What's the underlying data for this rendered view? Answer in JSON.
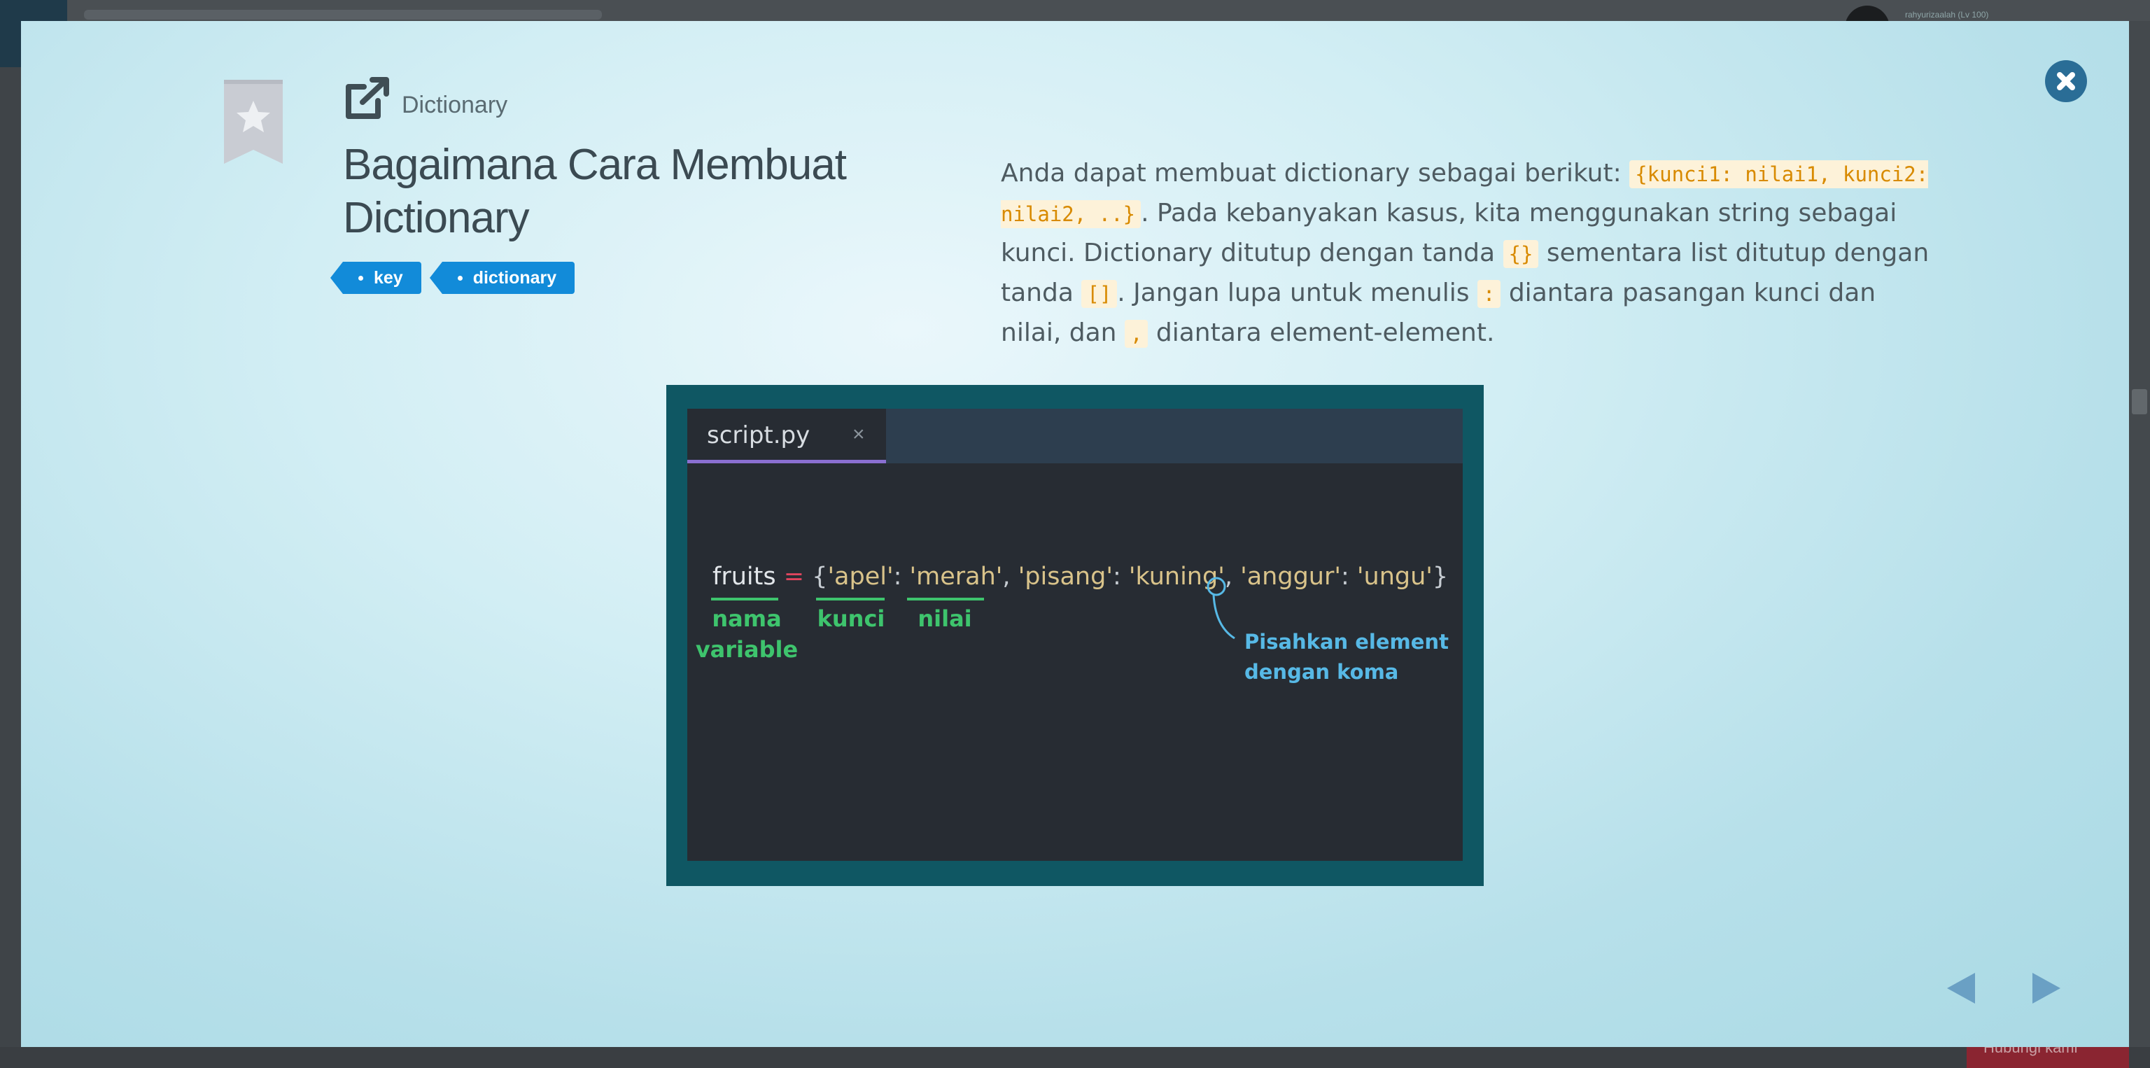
{
  "background": {
    "user_label": "rahyurizaalah (Lv 100)",
    "bottom_button_label": "Hubungi kami"
  },
  "modal": {
    "category": "Dictionary",
    "title": "Bagaimana Cara Membuat Dictionary",
    "tags": [
      "key",
      "dictionary"
    ],
    "description": {
      "p1": "Anda dapat membuat dictionary sebagai berikut: ",
      "code1": "{kunci1: nilai1, kunci2: nilai2, ..}",
      "p2": ". Pada kebanyakan kasus, kita menggunakan string sebagai kunci. Dictionary ditutup dengan tanda ",
      "code2": "{}",
      "p3": " sementara list ditutup dengan tanda ",
      "code3": "[]",
      "p4": ". Jangan lupa untuk menulis ",
      "code4": ":",
      "p5": " diantara pasangan kunci dan nilai, dan ",
      "code5": ",",
      "p6": " diantara element-element."
    },
    "code_image": {
      "tab_name": "script.py",
      "tab_close": "×",
      "line": {
        "var": "fruits",
        "op": " = ",
        "open": "{",
        "k1": "'apel'",
        "colon1": ": ",
        "v1": "'merah'",
        "sep1": ", ",
        "k2": "'pisang'",
        "colon2": ": ",
        "v2": "'kuning'",
        "sep2": ", ",
        "k3": "'anggur'",
        "colon3": ": ",
        "v3": "'ungu'",
        "close": "}"
      },
      "annotations": {
        "variable_line1": "nama",
        "variable_line2": "variable",
        "key": "kunci",
        "value": "nilai",
        "comma_line1": "Pisahkan element",
        "comma_line2": "dengan koma"
      }
    }
  },
  "colors": {
    "tag": "#128bd9",
    "close_button": "#2a6d96",
    "code_text": "#d88a00",
    "annotation_green": "#3ec46d",
    "annotation_blue": "#57b9e6"
  },
  "icons": [
    "close-icon",
    "bookmark-star-icon",
    "external-link-icon",
    "prev-arrow-icon",
    "next-arrow-icon"
  ]
}
